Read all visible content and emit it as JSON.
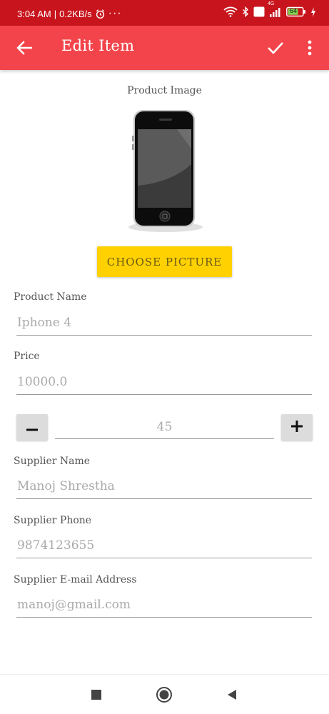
{
  "status_bar": {
    "time": "3:04 AM",
    "separator": "|",
    "network_speed": "0.2KB/s",
    "more": "···",
    "icons": [
      "alarm-icon",
      "wifi-icon",
      "bluetooth-icon",
      "volte-icon",
      "signal-icon",
      "battery-icon",
      "charging-icon"
    ],
    "network_type": "4G",
    "volte_label": "Vo LTE",
    "battery_level": "64"
  },
  "app_bar": {
    "title": "Edit Item",
    "background": "#f2444a"
  },
  "product_image": {
    "label": "Product Image",
    "choose_button": "CHOOSE PICTURE"
  },
  "form": {
    "product_name": {
      "label": "Product Name",
      "value": "Iphone 4"
    },
    "price": {
      "label": "Price",
      "value": "10000.0"
    },
    "quantity": {
      "value": "45",
      "decrement_icon": "minus-icon",
      "increment_icon": "plus-icon"
    },
    "supplier_name": {
      "label": "Supplier Name",
      "value": "Manoj Shrestha"
    },
    "supplier_phone": {
      "label": "Supplier Phone",
      "value": "9874123655"
    },
    "supplier_email": {
      "label": "Supplier E-mail Address",
      "value": "manoj@gmail.com"
    }
  },
  "colors": {
    "status_bar": "#c8141c",
    "accent_button": "#ffd100"
  },
  "nav_bar": {
    "icons": [
      "recents-square-icon",
      "home-circle-icon",
      "back-triangle-icon"
    ]
  }
}
